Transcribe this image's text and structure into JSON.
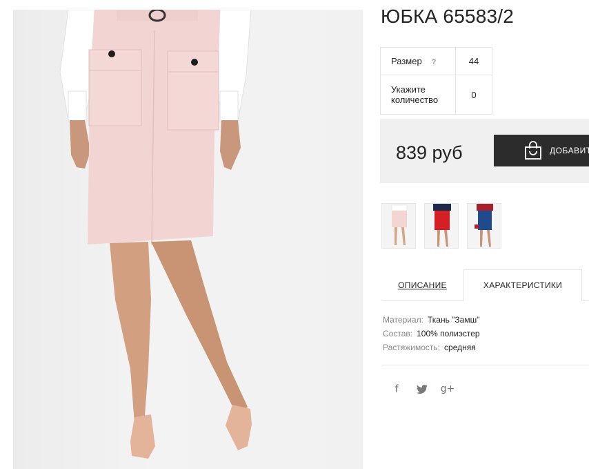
{
  "product": {
    "title": "ЮБКА 65583/2"
  },
  "options": {
    "size_label": "Размер",
    "size_help": "?",
    "size_value": "44",
    "qty_label": "Укажите количество",
    "qty_value": "0"
  },
  "buy": {
    "price": "839 руб",
    "add_label": "ДОБАВИТЬ"
  },
  "thumbnails": [
    {
      "name": "thumb-pink",
      "color": "#f3d6d4"
    },
    {
      "name": "thumb-red",
      "color": "#d41f26"
    },
    {
      "name": "thumb-navy",
      "color": "#1f4a8c"
    }
  ],
  "tabs": {
    "description": "ОПИСАНИЕ",
    "characteristics": "ХАРАКТЕРИСТИКИ"
  },
  "specs": [
    {
      "key": "Материал:",
      "value": "Ткань \"Замш\""
    },
    {
      "key": "Состав:",
      "value": "100% полиэстер"
    },
    {
      "key": "Растяжимость:",
      "value": "средняя"
    }
  ],
  "social": [
    {
      "icon": "facebook-icon",
      "glyph": "f"
    },
    {
      "icon": "twitter-icon",
      "glyph": "🐦"
    },
    {
      "icon": "google-plus-icon",
      "glyph": "g+"
    }
  ],
  "colors": {
    "skirt": "#f2d5d3",
    "button_dark": "#2c2c2c",
    "panel_bg": "#f0f0f0"
  }
}
